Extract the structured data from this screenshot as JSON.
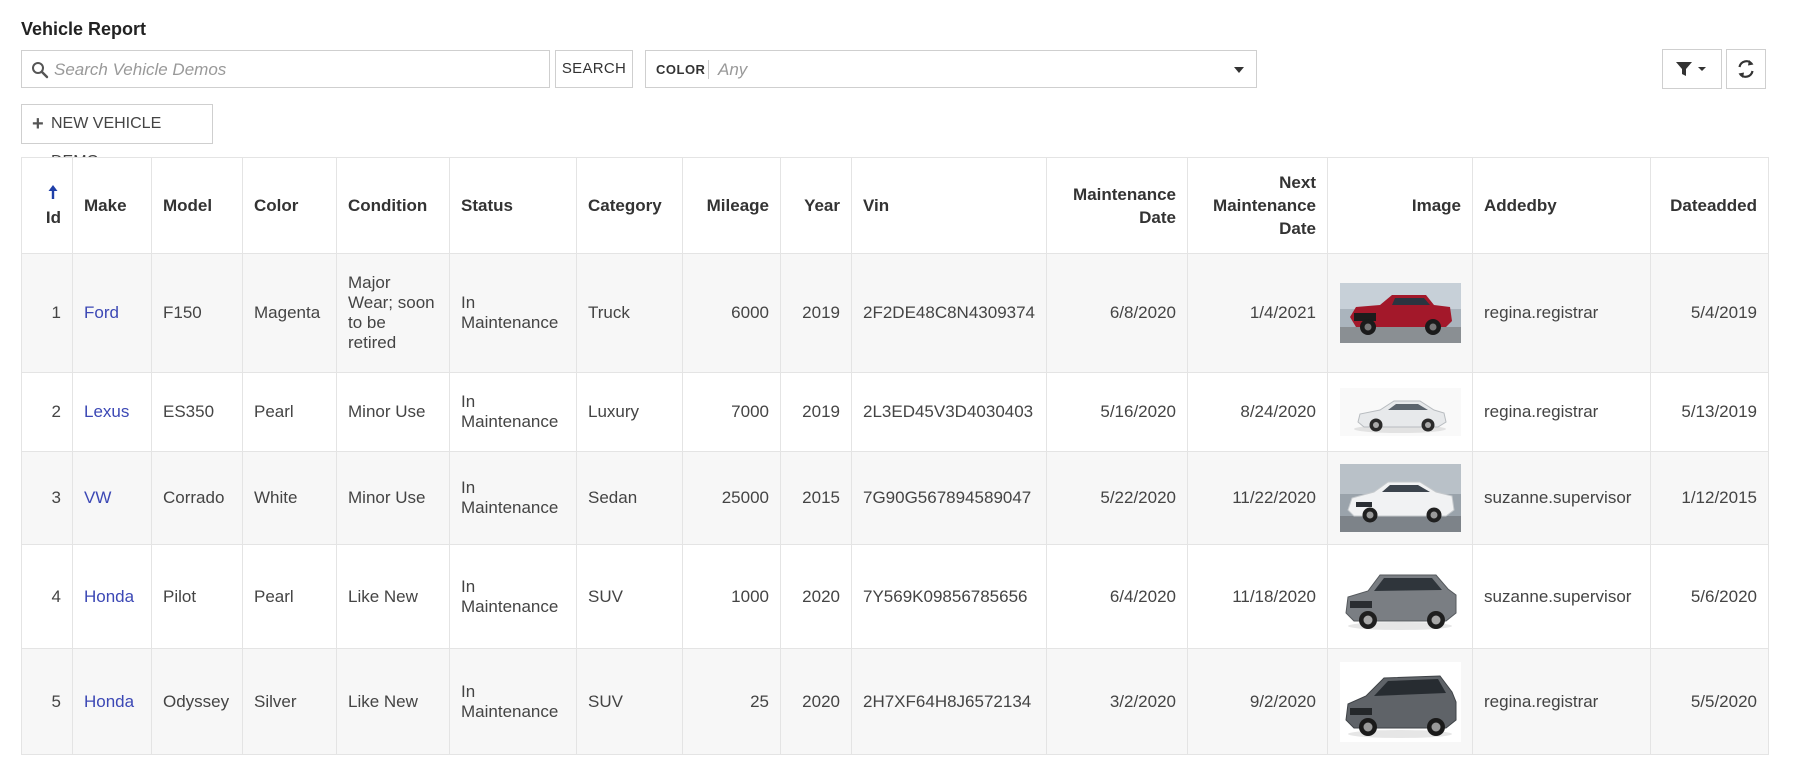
{
  "header": {
    "title": "Vehicle Report"
  },
  "toolbar": {
    "search_placeholder": "Search Vehicle Demos",
    "search_button": "SEARCH",
    "color_filter_label": "COLOR",
    "color_filter_value": "Any",
    "new_button": "NEW VEHICLE DEMO"
  },
  "table": {
    "columns": [
      {
        "key": "id",
        "label": "Id",
        "sorted": "ascending"
      },
      {
        "key": "make",
        "label": "Make"
      },
      {
        "key": "model",
        "label": "Model"
      },
      {
        "key": "color",
        "label": "Color"
      },
      {
        "key": "condition",
        "label": "Condition"
      },
      {
        "key": "status",
        "label": "Status"
      },
      {
        "key": "category",
        "label": "Category"
      },
      {
        "key": "mileage",
        "label": "Mileage"
      },
      {
        "key": "year",
        "label": "Year"
      },
      {
        "key": "vin",
        "label": "Vin"
      },
      {
        "key": "maintenance_date",
        "label": "Maintenance Date"
      },
      {
        "key": "next_maintenance_date",
        "label": "Next Maintenance Date"
      },
      {
        "key": "image",
        "label": "Image"
      },
      {
        "key": "addedby",
        "label": "Addedby"
      },
      {
        "key": "dateadded",
        "label": "Dateadded"
      }
    ],
    "rows": [
      {
        "id": "1",
        "make": "Ford",
        "model": "F150",
        "color": "Magenta",
        "condition": "Major Wear; soon to be retired",
        "status": "In Maintenance",
        "category": "Truck",
        "mileage": "6000",
        "year": "2019",
        "vin": "2F2DE48C8N4309374",
        "maintenance_date": "6/8/2020",
        "next_maintenance_date": "1/4/2021",
        "image": "red-pickup-truck",
        "addedby": "regina.registrar",
        "dateadded": "5/4/2019"
      },
      {
        "id": "2",
        "make": "Lexus",
        "model": "ES350",
        "color": "Pearl",
        "condition": "Minor Use",
        "status": "In Maintenance",
        "category": "Luxury",
        "mileage": "7000",
        "year": "2019",
        "vin": "2L3ED45V3D4030403",
        "maintenance_date": "5/16/2020",
        "next_maintenance_date": "8/24/2020",
        "image": "white-sedan",
        "addedby": "regina.registrar",
        "dateadded": "5/13/2019"
      },
      {
        "id": "3",
        "make": "VW",
        "model": "Corrado",
        "color": "White",
        "condition": "Minor Use",
        "status": "In Maintenance",
        "category": "Sedan",
        "mileage": "25000",
        "year": "2015",
        "vin": "7G90G567894589047",
        "maintenance_date": "5/22/2020",
        "next_maintenance_date": "11/22/2020",
        "image": "white-hatchback",
        "addedby": "suzanne.supervisor",
        "dateadded": "1/12/2015"
      },
      {
        "id": "4",
        "make": "Honda",
        "model": "Pilot",
        "color": "Pearl",
        "condition": "Like New",
        "status": "In Maintenance",
        "category": "SUV",
        "mileage": "1000",
        "year": "2020",
        "vin": "7Y569K09856785656",
        "maintenance_date": "6/4/2020",
        "next_maintenance_date": "11/18/2020",
        "image": "gray-suv",
        "addedby": "suzanne.supervisor",
        "dateadded": "5/6/2020"
      },
      {
        "id": "5",
        "make": "Honda",
        "model": "Odyssey",
        "color": "Silver",
        "condition": "Like New",
        "status": "In Maintenance",
        "category": "SUV",
        "mileage": "25",
        "year": "2020",
        "vin": "2H7XF64H8J6572134",
        "maintenance_date": "3/2/2020",
        "next_maintenance_date": "9/2/2020",
        "image": "gray-minivan",
        "addedby": "regina.registrar",
        "dateadded": "5/5/2020"
      }
    ]
  },
  "colors": {
    "link": "#3c48b5",
    "sort_arrow": "#1f3fa8",
    "row_alt": "#f7f7f7",
    "border": "#e4e4e4"
  },
  "icons": {
    "search": "search-icon",
    "filter": "filter-icon",
    "refresh": "refresh-icon",
    "plus": "plus-icon",
    "sort": "sort-ascending-icon",
    "dropdown": "chevron-down-icon"
  }
}
